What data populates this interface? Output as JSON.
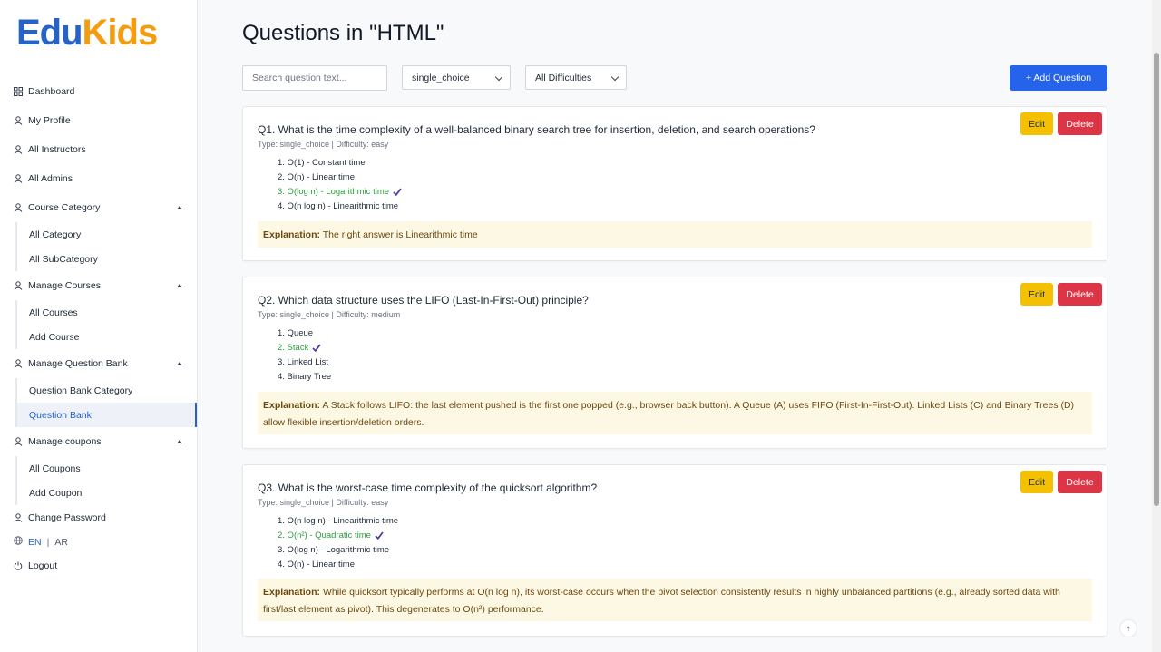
{
  "brand": {
    "part1": "Edu",
    "part2": "Kids",
    "color1": "#2563c9",
    "color2": "#f39c12"
  },
  "sidebar": {
    "items": [
      {
        "label": "Dashboard",
        "icon": "grid-icon"
      },
      {
        "label": "My Profile",
        "icon": "user-icon"
      },
      {
        "label": "All Instructors",
        "icon": "user-icon"
      },
      {
        "label": "All Admins",
        "icon": "user-icon"
      },
      {
        "label": "Course Category",
        "icon": "user-icon",
        "expanded": true,
        "children": [
          "All Category",
          "All SubCategory"
        ]
      },
      {
        "label": "Manage Courses",
        "icon": "user-icon",
        "expanded": true,
        "children": [
          "All Courses",
          "Add Course"
        ]
      },
      {
        "label": "Manage Question Bank",
        "icon": "user-icon",
        "expanded": true,
        "children": [
          "Question Bank Category",
          "Question Bank"
        ]
      },
      {
        "label": "Manage coupons",
        "icon": "user-icon",
        "expanded": true,
        "children": [
          "All Coupons",
          "Add Coupon"
        ]
      },
      {
        "label": "Change Password",
        "icon": "user-icon"
      },
      {
        "label": "Logout",
        "icon": "power-icon"
      }
    ],
    "active": "Question Bank",
    "lang": {
      "en": "EN",
      "sep": "|",
      "ar": "AR"
    }
  },
  "page": {
    "title": "Questions in \"HTML\""
  },
  "toolbar": {
    "search_placeholder": "Search question text...",
    "type_filter": "single_choice",
    "difficulty_filter": "All Difficulties",
    "add_label": "+ Add Question"
  },
  "actions": {
    "edit": "Edit",
    "delete": "Delete"
  },
  "questions": [
    {
      "title": "Q1. What is the time complexity of a well-balanced binary search tree for insertion, deletion, and search operations?",
      "meta": "Type: single_choice | Difficulty: easy",
      "options": [
        "1. O(1) - Constant time",
        "2. O(n) - Linear time",
        "3. O(log n) - Logarithmic time",
        "4. O(n log n) - Linearithmic time"
      ],
      "correct": 2,
      "explanation_label": "Explanation:",
      "explanation": "The right answer is Linearithmic time"
    },
    {
      "title": "Q2. Which data structure uses the LIFO (Last-In-First-Out) principle?",
      "meta": "Type: single_choice | Difficulty: medium",
      "options": [
        "1. Queue",
        "2. Stack",
        "3. Linked List",
        "4. Binary Tree"
      ],
      "correct": 1,
      "explanation_label": "Explanation:",
      "explanation": "A Stack follows LIFO: the last element pushed is the first one popped (e.g., browser back button). A Queue (A) uses FIFO (First-In-First-Out). Linked Lists (C) and Binary Trees (D) allow flexible insertion/deletion orders."
    },
    {
      "title": "Q3. What is the worst-case time complexity of the quicksort algorithm?",
      "meta": "Type: single_choice | Difficulty: easy",
      "options": [
        "1. O(n log n) - Linearithmic time",
        "2. O(n²) - Quadratic time",
        "3. O(log n) - Logarithmic time",
        "4. O(n) - Linear time"
      ],
      "correct": 1,
      "explanation_label": "Explanation:",
      "explanation": "While quicksort typically performs at O(n log n), its worst-case occurs when the pivot selection consistently results in highly unbalanced partitions (e.g., already sorted data with first/last element as pivot). This degenerates to O(n²) performance."
    }
  ],
  "colors": {
    "primary": "#2563eb",
    "edit": "#f5c000",
    "delete": "#dc3545",
    "correct": "#2e9b3d",
    "explanation_bg": "#fdf8e4"
  }
}
